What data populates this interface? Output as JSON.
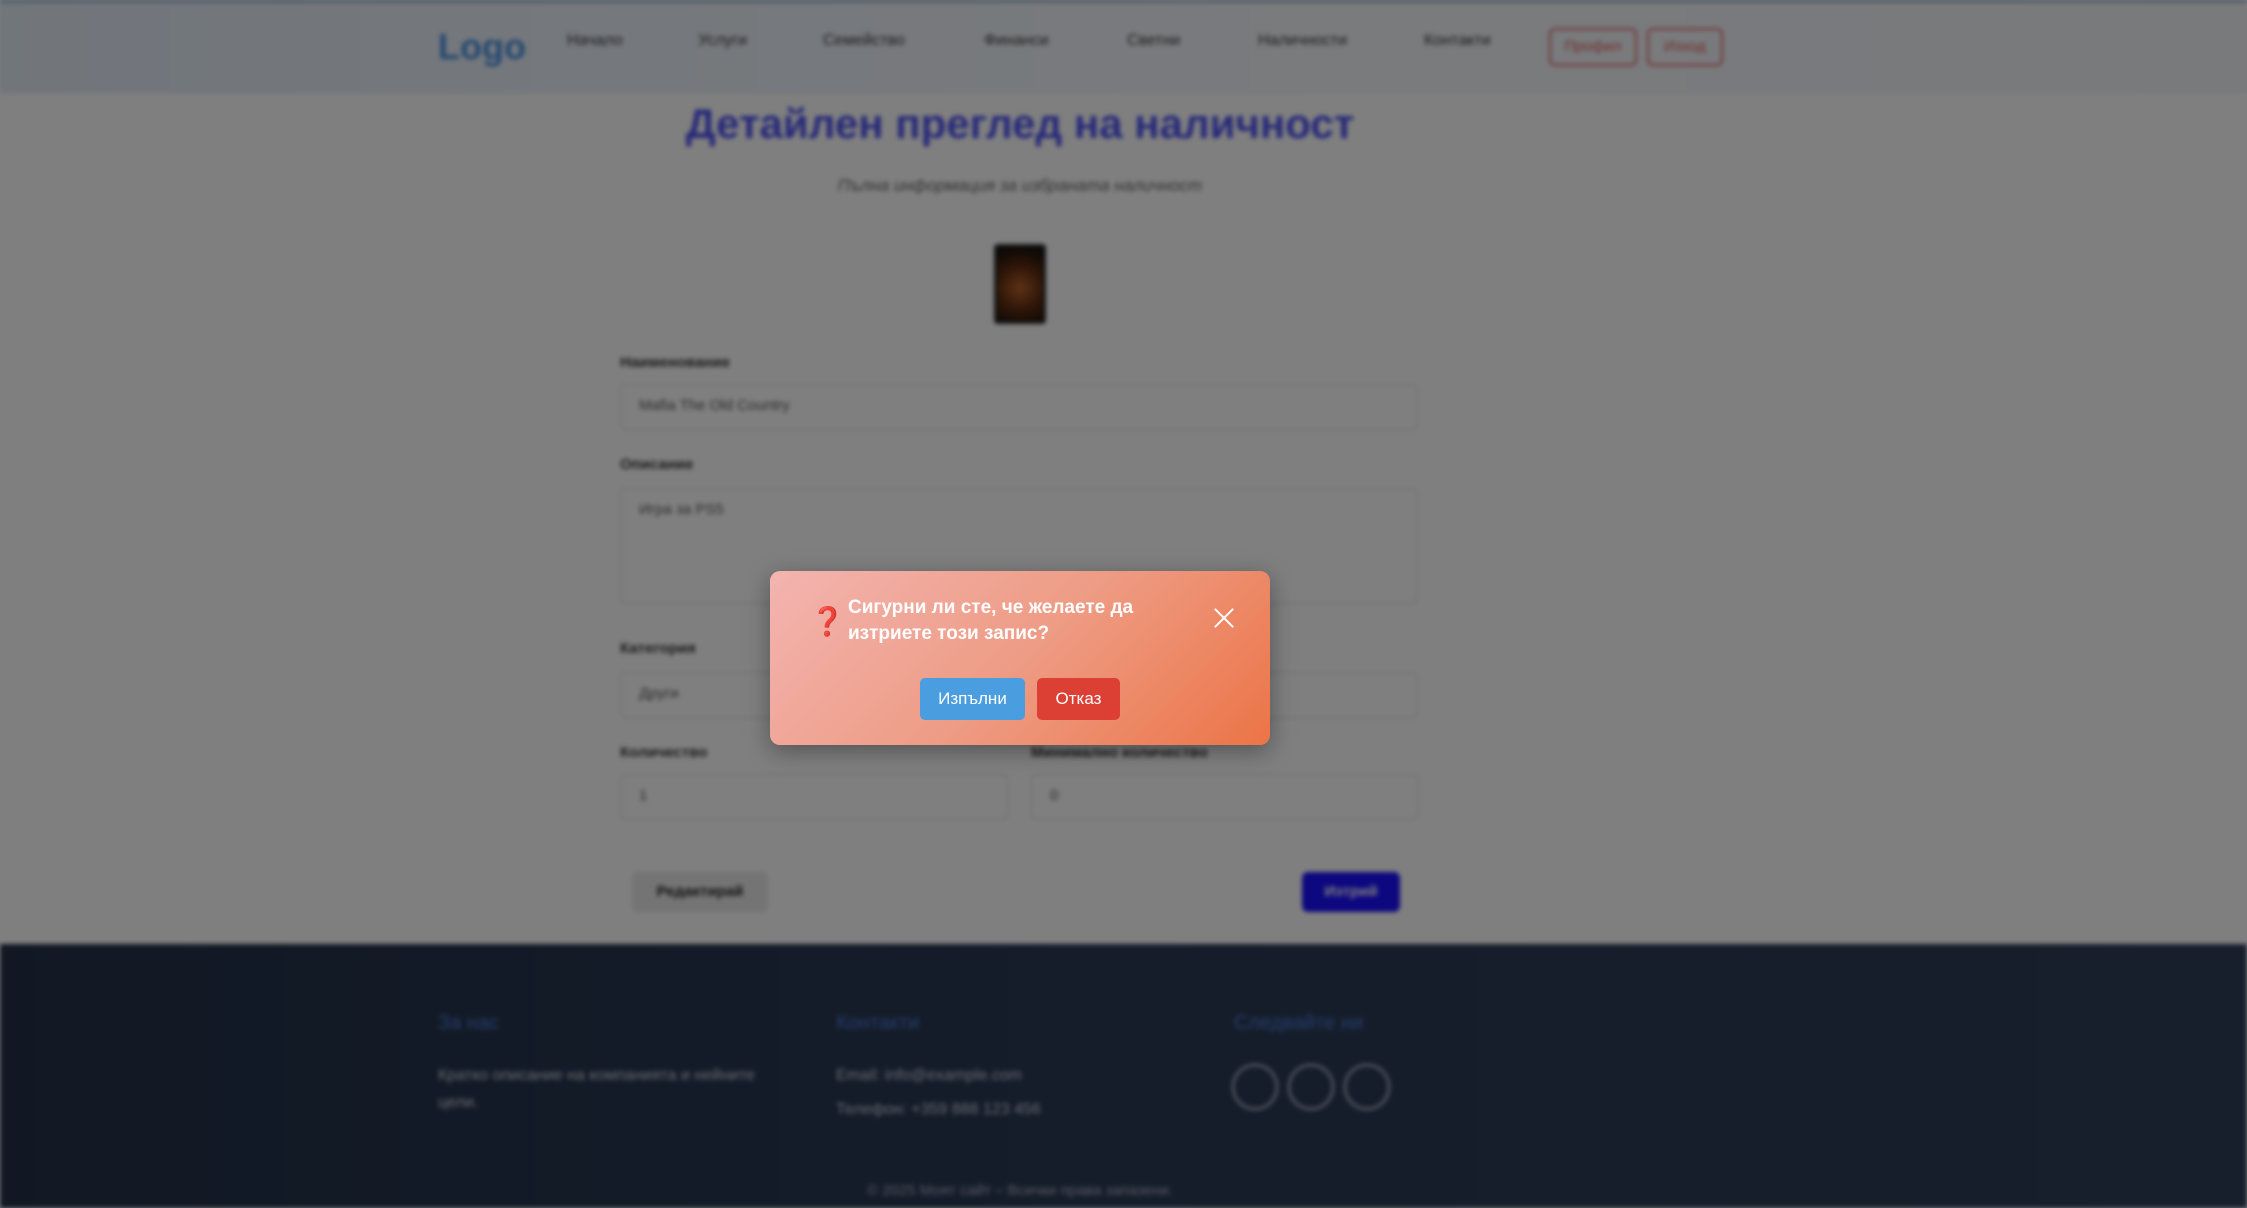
{
  "header": {
    "logo": "Logo",
    "nav": [
      "Начало",
      "Услуги",
      "Семейство",
      "Финанси",
      "Светни",
      "Наличности",
      "Контакти"
    ],
    "profile_label": "Профил",
    "logout_label": "Изход"
  },
  "main": {
    "title": "Детайлен преглед на наличност",
    "subtitle": "Пълна информация за избраната наличност",
    "name_label": "Наименование",
    "name_value": "Mafia The Old Country",
    "description_label": "Описание",
    "description_value": "Игра за PS5",
    "category_label": "Категория",
    "category_value": "Други",
    "quantity_label": "Количество",
    "quantity_value": "1",
    "min_quantity_label": "Минимално количество",
    "min_quantity_value": "0",
    "edit_label": "Редактирай",
    "delete_label": "Изтрий"
  },
  "footer": {
    "about_heading": "За нас",
    "about_text": "Кратко описание на компанията и нейните цели.",
    "contacts_heading": "Контакти",
    "email": "Email: info@example.com",
    "phone": "Телефон: +359 888 123 456",
    "follow_heading": "Следвайте ни",
    "social_icons": [
      "facebook-icon",
      "twitter-icon",
      "instagram-icon"
    ],
    "copyright": "© 2025 Моят сайт – Всички права запазени."
  },
  "dialog": {
    "message": "Сигурни ли сте, че желаете да изтриете този запис?",
    "confirm_label": "Изпълни",
    "cancel_label": "Отказ"
  },
  "colors": {
    "accent_blue": "#4a90e2",
    "title_purple": "#4b4ef0",
    "delete_blue": "#1a10ff",
    "dialog_confirm": "#4a9ee0",
    "dialog_cancel": "#dc4035",
    "footer_bg": "#233149"
  }
}
